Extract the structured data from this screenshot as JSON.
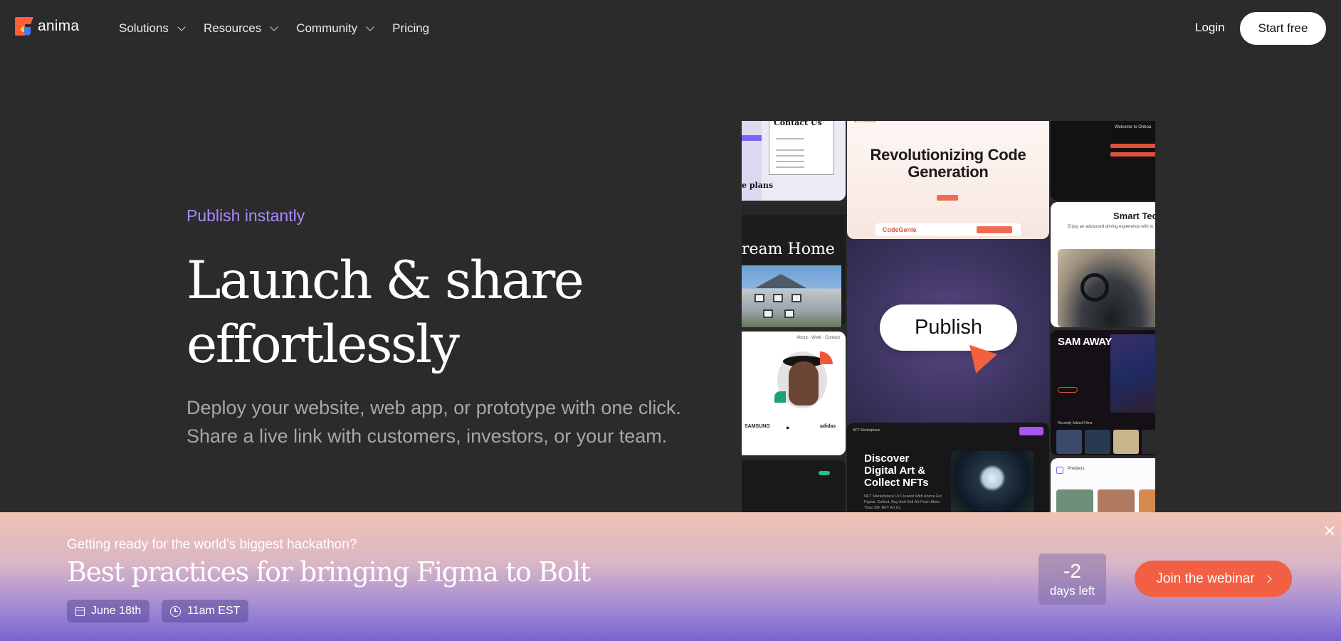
{
  "nav": {
    "logo_text": "anima",
    "menu": [
      {
        "label": "Solutions",
        "has_dropdown": true
      },
      {
        "label": "Resources",
        "has_dropdown": true
      },
      {
        "label": "Community",
        "has_dropdown": true
      },
      {
        "label": "Pricing",
        "has_dropdown": false
      }
    ],
    "login_label": "Login",
    "start_label": "Start free"
  },
  "hero": {
    "eyebrow": "Publish instantly",
    "headline_line1": "Launch & share",
    "headline_line2": "effortlessly",
    "sub_line1": "Deploy your website, web app, or prototype with one click.",
    "sub_line2": "Share a live link with customers, investors, or your team."
  },
  "collage": {
    "contact_title": "Contact Us",
    "plans_text": "e plans",
    "dream_home": "ream Home",
    "brands": [
      "SAMSUNG",
      "",
      "adidas"
    ],
    "codegen_headline": "Revolutionizing Code Generation",
    "codegen_brand": "CodeGenie",
    "publish_label": "Publish",
    "nft_nav": "NFT Marketplace",
    "nft_title_line1": "Discover",
    "nft_title_line2": "Digital Art &",
    "nft_title_line3": "Collect NFTs",
    "nft_desc": "NFT Marketplace UI Created With Anima For Figma. Collect, Buy And Sell Art From More Than 20k NFT Art Irs.",
    "welcome_text": "Welcome to Onboa",
    "smart_title": "Smart Tec",
    "smart_desc": "Enjoy an advanced driving experience with in",
    "sam_title": "SAM AWAY",
    "recent_label": "Recently Added Films",
    "products_label": "Products",
    "colors": {
      "accent_purple": "#7d63f5",
      "accent_red": "#f06b54",
      "publish_bg": "#3d3460"
    }
  },
  "banner": {
    "kicker": "Getting ready for the world’s biggest hackathon?",
    "title": "Best practices for bringing Figma to Bolt",
    "date_chip": "June 18th",
    "time_chip": "11am EST",
    "countdown_num": "-2",
    "countdown_label": "days left",
    "cta_label": "Join the webinar",
    "colors": {
      "cta": "#f25f43",
      "gradient_top": "#f2c3b5",
      "gradient_bottom": "#7b63d0"
    }
  }
}
